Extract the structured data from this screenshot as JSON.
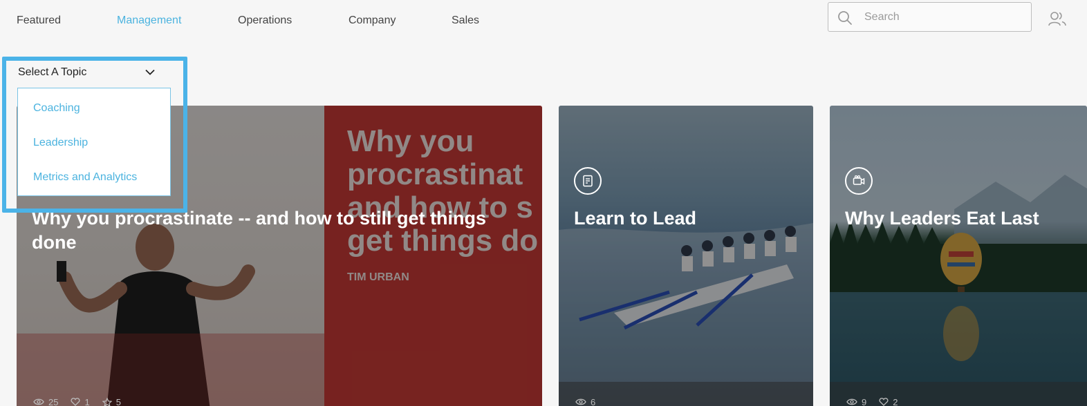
{
  "nav": {
    "tabs": [
      {
        "label": "Featured",
        "active": false
      },
      {
        "label": "Management",
        "active": true
      },
      {
        "label": "Operations",
        "active": false
      },
      {
        "label": "Company",
        "active": false
      },
      {
        "label": "Sales",
        "active": false
      }
    ]
  },
  "search": {
    "placeholder": "Search",
    "value": ""
  },
  "topic_select": {
    "label": "Select A Topic",
    "options": [
      "Coaching",
      "Leadership",
      "Metrics and Analytics"
    ]
  },
  "cards": [
    {
      "title": "Why you procrastinate -- and how to still get things done",
      "type_icon": "",
      "stats": {
        "views": "25",
        "likes": "1",
        "favorites": "5"
      },
      "thumbnail_text": [
        "Why you",
        "procrastinat",
        "and how to s",
        "get things do"
      ],
      "thumbnail_sub": "TIM URBAN"
    },
    {
      "title": "Learn to Lead",
      "type_icon": "document-icon",
      "stats": {
        "views": "6"
      }
    },
    {
      "title": "Why Leaders Eat Last",
      "type_icon": "video-icon",
      "stats": {
        "views": "9",
        "likes": "2"
      }
    }
  ],
  "colors": {
    "accent": "#4bb3df",
    "highlight": "#4bb3e8",
    "background": "#f6f6f6"
  }
}
